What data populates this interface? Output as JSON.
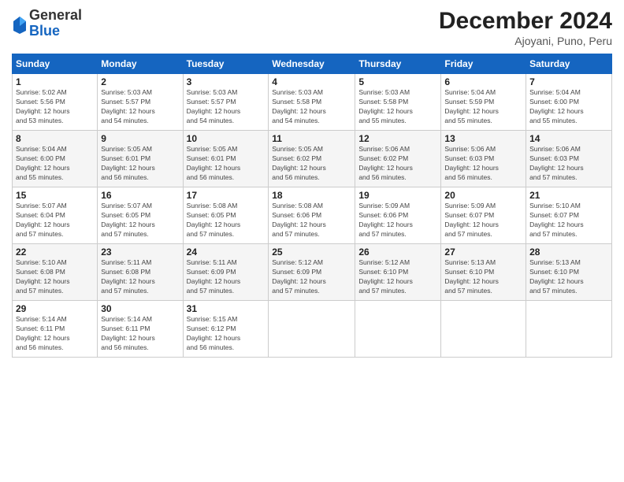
{
  "logo": {
    "general": "General",
    "blue": "Blue"
  },
  "title": "December 2024",
  "subtitle": "Ajoyani, Puno, Peru",
  "days_header": [
    "Sunday",
    "Monday",
    "Tuesday",
    "Wednesday",
    "Thursday",
    "Friday",
    "Saturday"
  ],
  "weeks": [
    [
      {
        "day": "1",
        "info": "Sunrise: 5:02 AM\nSunset: 5:56 PM\nDaylight: 12 hours\nand 53 minutes."
      },
      {
        "day": "2",
        "info": "Sunrise: 5:03 AM\nSunset: 5:57 PM\nDaylight: 12 hours\nand 54 minutes."
      },
      {
        "day": "3",
        "info": "Sunrise: 5:03 AM\nSunset: 5:57 PM\nDaylight: 12 hours\nand 54 minutes."
      },
      {
        "day": "4",
        "info": "Sunrise: 5:03 AM\nSunset: 5:58 PM\nDaylight: 12 hours\nand 54 minutes."
      },
      {
        "day": "5",
        "info": "Sunrise: 5:03 AM\nSunset: 5:58 PM\nDaylight: 12 hours\nand 55 minutes."
      },
      {
        "day": "6",
        "info": "Sunrise: 5:04 AM\nSunset: 5:59 PM\nDaylight: 12 hours\nand 55 minutes."
      },
      {
        "day": "7",
        "info": "Sunrise: 5:04 AM\nSunset: 6:00 PM\nDaylight: 12 hours\nand 55 minutes."
      }
    ],
    [
      {
        "day": "8",
        "info": "Sunrise: 5:04 AM\nSunset: 6:00 PM\nDaylight: 12 hours\nand 55 minutes."
      },
      {
        "day": "9",
        "info": "Sunrise: 5:05 AM\nSunset: 6:01 PM\nDaylight: 12 hours\nand 56 minutes."
      },
      {
        "day": "10",
        "info": "Sunrise: 5:05 AM\nSunset: 6:01 PM\nDaylight: 12 hours\nand 56 minutes."
      },
      {
        "day": "11",
        "info": "Sunrise: 5:05 AM\nSunset: 6:02 PM\nDaylight: 12 hours\nand 56 minutes."
      },
      {
        "day": "12",
        "info": "Sunrise: 5:06 AM\nSunset: 6:02 PM\nDaylight: 12 hours\nand 56 minutes."
      },
      {
        "day": "13",
        "info": "Sunrise: 5:06 AM\nSunset: 6:03 PM\nDaylight: 12 hours\nand 56 minutes."
      },
      {
        "day": "14",
        "info": "Sunrise: 5:06 AM\nSunset: 6:03 PM\nDaylight: 12 hours\nand 57 minutes."
      }
    ],
    [
      {
        "day": "15",
        "info": "Sunrise: 5:07 AM\nSunset: 6:04 PM\nDaylight: 12 hours\nand 57 minutes."
      },
      {
        "day": "16",
        "info": "Sunrise: 5:07 AM\nSunset: 6:05 PM\nDaylight: 12 hours\nand 57 minutes."
      },
      {
        "day": "17",
        "info": "Sunrise: 5:08 AM\nSunset: 6:05 PM\nDaylight: 12 hours\nand 57 minutes."
      },
      {
        "day": "18",
        "info": "Sunrise: 5:08 AM\nSunset: 6:06 PM\nDaylight: 12 hours\nand 57 minutes."
      },
      {
        "day": "19",
        "info": "Sunrise: 5:09 AM\nSunset: 6:06 PM\nDaylight: 12 hours\nand 57 minutes."
      },
      {
        "day": "20",
        "info": "Sunrise: 5:09 AM\nSunset: 6:07 PM\nDaylight: 12 hours\nand 57 minutes."
      },
      {
        "day": "21",
        "info": "Sunrise: 5:10 AM\nSunset: 6:07 PM\nDaylight: 12 hours\nand 57 minutes."
      }
    ],
    [
      {
        "day": "22",
        "info": "Sunrise: 5:10 AM\nSunset: 6:08 PM\nDaylight: 12 hours\nand 57 minutes."
      },
      {
        "day": "23",
        "info": "Sunrise: 5:11 AM\nSunset: 6:08 PM\nDaylight: 12 hours\nand 57 minutes."
      },
      {
        "day": "24",
        "info": "Sunrise: 5:11 AM\nSunset: 6:09 PM\nDaylight: 12 hours\nand 57 minutes."
      },
      {
        "day": "25",
        "info": "Sunrise: 5:12 AM\nSunset: 6:09 PM\nDaylight: 12 hours\nand 57 minutes."
      },
      {
        "day": "26",
        "info": "Sunrise: 5:12 AM\nSunset: 6:10 PM\nDaylight: 12 hours\nand 57 minutes."
      },
      {
        "day": "27",
        "info": "Sunrise: 5:13 AM\nSunset: 6:10 PM\nDaylight: 12 hours\nand 57 minutes."
      },
      {
        "day": "28",
        "info": "Sunrise: 5:13 AM\nSunset: 6:10 PM\nDaylight: 12 hours\nand 57 minutes."
      }
    ],
    [
      {
        "day": "29",
        "info": "Sunrise: 5:14 AM\nSunset: 6:11 PM\nDaylight: 12 hours\nand 56 minutes."
      },
      {
        "day": "30",
        "info": "Sunrise: 5:14 AM\nSunset: 6:11 PM\nDaylight: 12 hours\nand 56 minutes."
      },
      {
        "day": "31",
        "info": "Sunrise: 5:15 AM\nSunset: 6:12 PM\nDaylight: 12 hours\nand 56 minutes."
      },
      {
        "day": "",
        "info": ""
      },
      {
        "day": "",
        "info": ""
      },
      {
        "day": "",
        "info": ""
      },
      {
        "day": "",
        "info": ""
      }
    ]
  ]
}
